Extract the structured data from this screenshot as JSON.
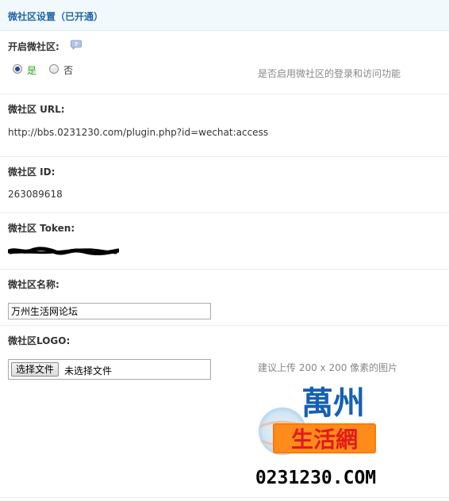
{
  "header": {
    "title": "微社区设置（已开通）"
  },
  "enable": {
    "label": "开启微社区:",
    "options": [
      "是",
      "否"
    ],
    "selected": "是",
    "tip": "是否启用微社区的登录和访问功能"
  },
  "url": {
    "label": "微社区 URL:",
    "value": "http://bbs.0231230.com/plugin.php?id=wechat:access"
  },
  "id_field": {
    "label": "微社区 ID:",
    "value": "263089618"
  },
  "token": {
    "label": "微社区 Token:"
  },
  "name": {
    "label": "微社区名称:",
    "value": "万州生活网论坛"
  },
  "logo": {
    "label": "微社区LOGO:",
    "button_label": "选择文件",
    "file_status": "未选择文件",
    "tip": "建议上传 200 x 200 像素的图片",
    "line1": "萬州",
    "line2": "生活網",
    "line3": "0231230.COM"
  },
  "colors": {
    "header_text": "#2366a8",
    "header_bg": "#f2f9fd",
    "logo_blue": "#1560b4",
    "logo_orange": "#ff7a00",
    "logo_red": "#e01b1b"
  }
}
